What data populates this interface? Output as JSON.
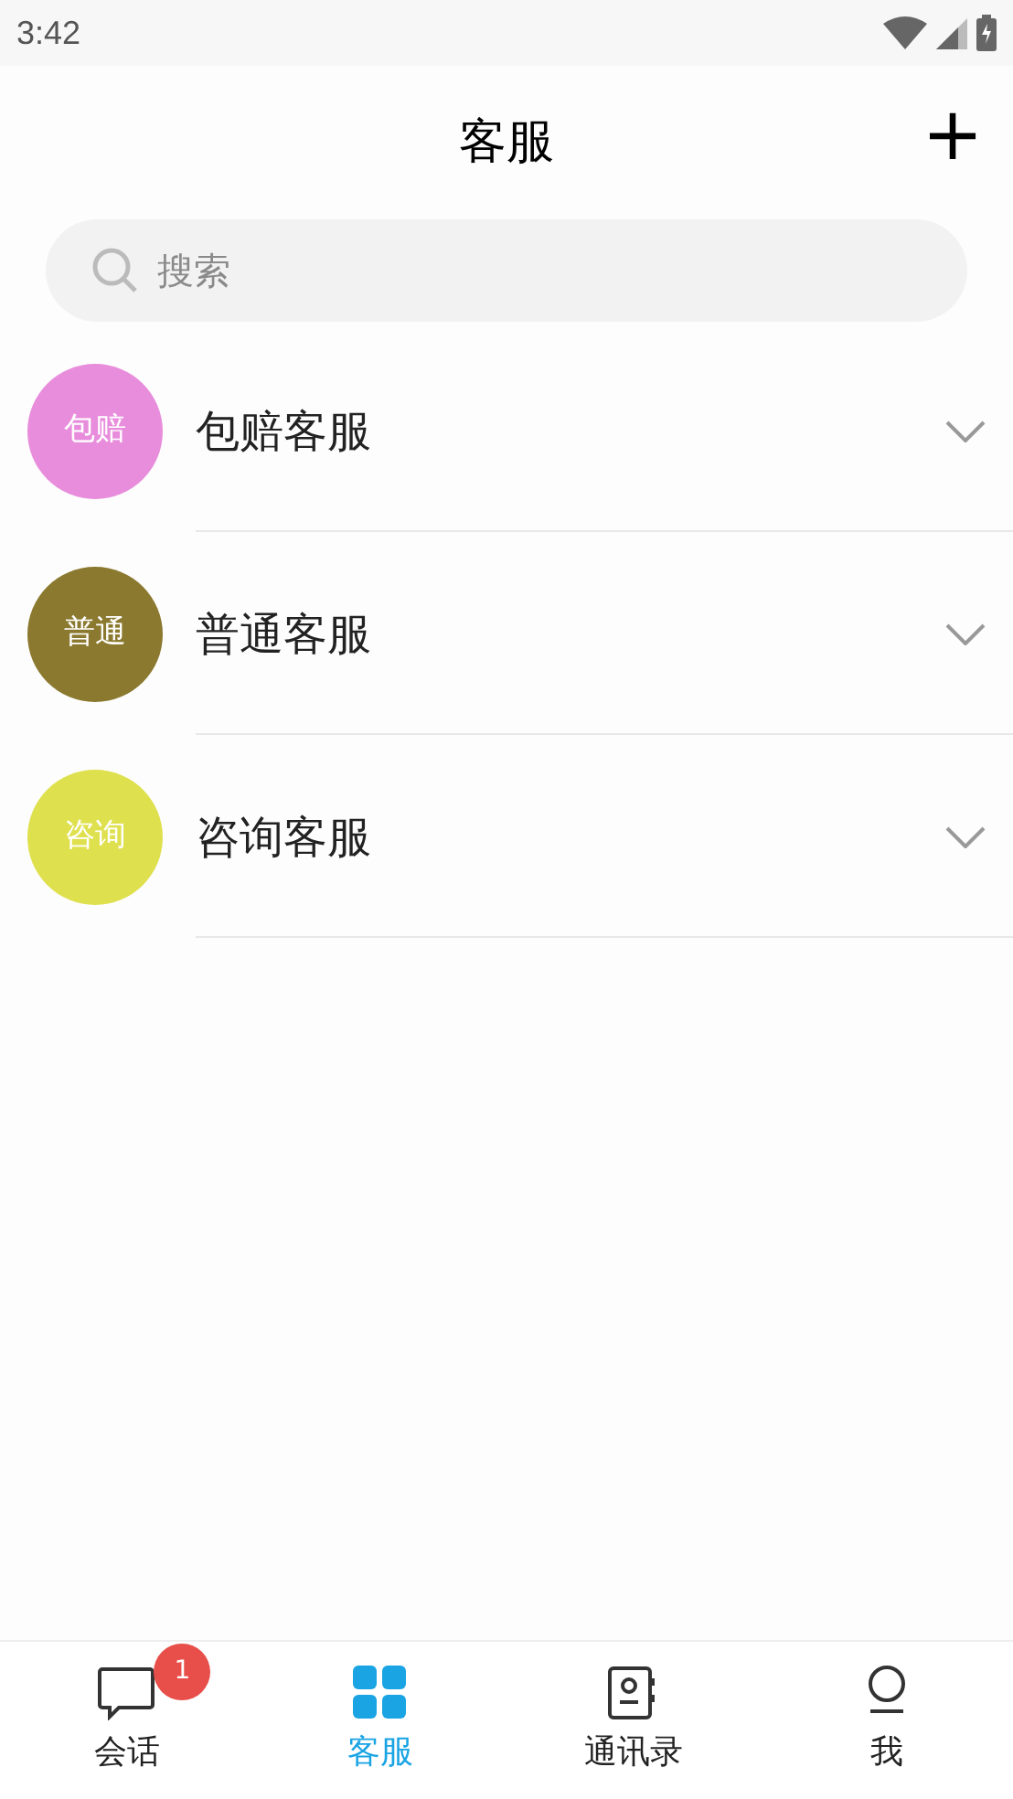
{
  "status_bar": {
    "time": "3:42"
  },
  "header": {
    "title": "客服",
    "add_button": "+"
  },
  "search": {
    "placeholder": "搜索"
  },
  "groups": [
    {
      "avatar": "包赔",
      "name": "包赔客服",
      "color": "#e88ddc"
    },
    {
      "avatar": "普通",
      "name": "普通客服",
      "color": "#8b792f"
    },
    {
      "avatar": "咨询",
      "name": "咨询客服",
      "color": "#dfe04d"
    }
  ],
  "tabs": [
    {
      "kind": "chat",
      "label": "会话",
      "selected": false,
      "badge": "1"
    },
    {
      "kind": "grid",
      "label": "客服",
      "selected": true
    },
    {
      "kind": "contacts",
      "label": "通讯录",
      "selected": false
    },
    {
      "kind": "person",
      "label": "我",
      "selected": false
    }
  ]
}
